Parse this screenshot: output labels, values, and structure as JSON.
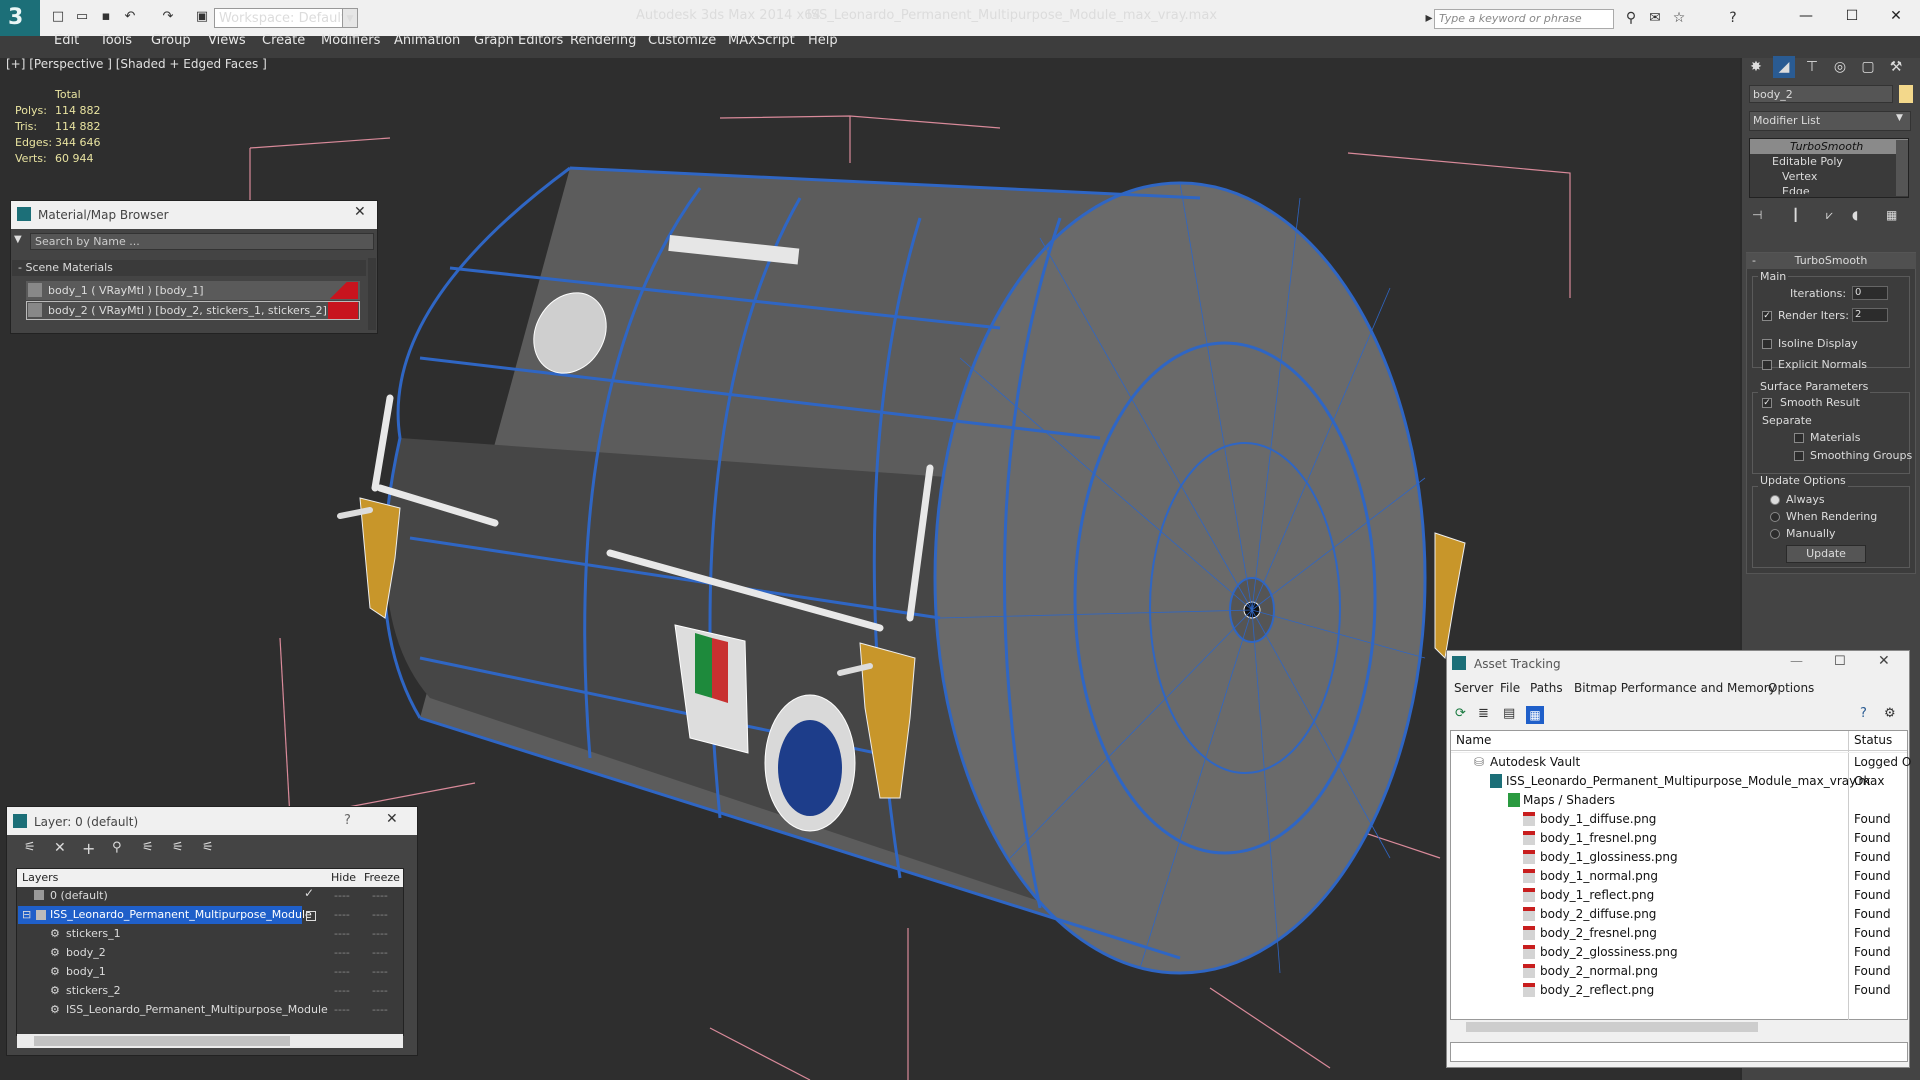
{
  "titlebar": {
    "workspace_label": "Workspace: Default",
    "app_title": "Autodesk 3ds Max  2014 x64",
    "doc_title": "ISS_Leonardo_Permanent_Multipurpose_Module_max_vray.max",
    "search_placeholder": "Type a keyword or phrase"
  },
  "menus": [
    "Edit",
    "Tools",
    "Group",
    "Views",
    "Create",
    "Modifiers",
    "Animation",
    "Graph Editors",
    "Rendering",
    "Customize",
    "MAXScript",
    "Help"
  ],
  "viewport": {
    "label": "[+] [Perspective ] [Shaded + Edged Faces ]",
    "stats": {
      "header": "Total",
      "rows": [
        {
          "label": "Polys:",
          "value": "114 882"
        },
        {
          "label": "Tris:",
          "value": "114 882"
        },
        {
          "label": "Edges:",
          "value": "344 646"
        },
        {
          "label": "Verts:",
          "value": "60 944"
        }
      ]
    }
  },
  "material_browser": {
    "title": "Material/Map Browser",
    "search_placeholder": "Search by Name ...",
    "section": "- Scene Materials",
    "items": [
      "body_1  ( VRayMtl )  [body_1]",
      "body_2  ( VRayMtl )  [body_2, stickers_1, stickers_2]"
    ]
  },
  "command_panel": {
    "object_name": "body_2",
    "modifier_list": "Modifier List",
    "stack": [
      "TurboSmooth",
      "Editable Poly",
      "Vertex",
      "Edge"
    ],
    "rollout": "TurboSmooth",
    "main_label": "Main",
    "iterations_label": "Iterations:",
    "iterations_value": "0",
    "render_iters_label": "Render Iters:",
    "render_iters_value": "2",
    "isoline": "Isoline Display",
    "explicit_normals": "Explicit Normals",
    "surface_params": "Surface Parameters",
    "smooth_result": "Smooth Result",
    "separate": "Separate",
    "materials": "Materials",
    "smoothing_groups": "Smoothing Groups",
    "update_options": "Update Options",
    "always": "Always",
    "when_rendering": "When Rendering",
    "manually": "Manually",
    "update_button": "Update"
  },
  "layer_dialog": {
    "title": "Layer: 0 (default)",
    "help": "?",
    "col_layers": "Layers",
    "col_hide": "Hide",
    "col_freeze": "Freeze",
    "rows": [
      "0 (default)",
      "ISS_Leonardo_Permanent_Multipurpose_Module",
      "stickers_1",
      "body_2",
      "body_1",
      "stickers_2",
      "ISS_Leonardo_Permanent_Multipurpose_Module"
    ],
    "dash": "----"
  },
  "asset_tracking": {
    "title": "Asset Tracking",
    "menus": [
      "Server",
      "File",
      "Paths",
      "Bitmap Performance and Memory",
      "Options"
    ],
    "col_name": "Name",
    "col_status": "Status",
    "rows": [
      {
        "name": "Autodesk Vault",
        "status": "Logged O"
      },
      {
        "name": "ISS_Leonardo_Permanent_Multipurpose_Module_max_vray.max",
        "status": "Ok"
      },
      {
        "name": "Maps / Shaders",
        "status": ""
      },
      {
        "name": "body_1_diffuse.png",
        "status": "Found"
      },
      {
        "name": "body_1_fresnel.png",
        "status": "Found"
      },
      {
        "name": "body_1_glossiness.png",
        "status": "Found"
      },
      {
        "name": "body_1_normal.png",
        "status": "Found"
      },
      {
        "name": "body_1_reflect.png",
        "status": "Found"
      },
      {
        "name": "body_2_diffuse.png",
        "status": "Found"
      },
      {
        "name": "body_2_fresnel.png",
        "status": "Found"
      },
      {
        "name": "body_2_glossiness.png",
        "status": "Found"
      },
      {
        "name": "body_2_normal.png",
        "status": "Found"
      },
      {
        "name": "body_2_reflect.png",
        "status": "Found"
      }
    ]
  },
  "colors": {
    "wire": "#2f66c4",
    "accent": "#1c6f78",
    "selection": "#1f5fc9",
    "bracket": "#c8962a"
  }
}
